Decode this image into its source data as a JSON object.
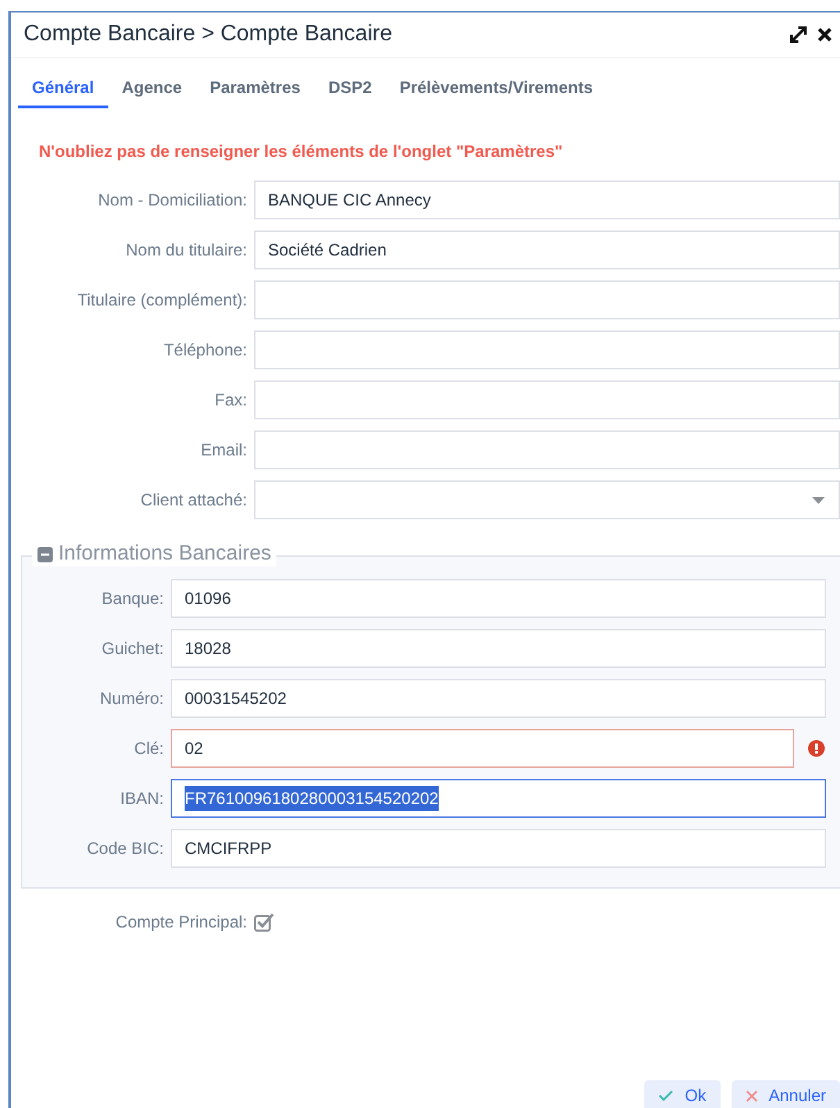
{
  "window": {
    "title": "Compte Bancaire > Compte Bancaire"
  },
  "tabs": [
    {
      "label": "Général",
      "selected": true
    },
    {
      "label": "Agence",
      "selected": false
    },
    {
      "label": "Paramètres",
      "selected": false
    },
    {
      "label": "DSP2",
      "selected": false
    },
    {
      "label": "Prélèvements/Virements",
      "selected": false
    }
  ],
  "warning": "N'oubliez pas de renseigner les éléments de l'onglet \"Paramètres\"",
  "fields": [
    {
      "label": "Nom - Domiciliation:",
      "value": "BANQUE CIC Annecy",
      "kind": "text"
    },
    {
      "label": "Nom du titulaire:",
      "value": "Société Cadrien",
      "kind": "text"
    },
    {
      "label": "Titulaire (complément):",
      "kind": "text"
    },
    {
      "label": "Téléphone:",
      "kind": "text"
    },
    {
      "label": "Fax:",
      "kind": "text"
    },
    {
      "label": "Email:",
      "kind": "text"
    },
    {
      "label": "Client attaché:",
      "kind": "select"
    }
  ],
  "bank_info": {
    "legend": "Informations Bancaires",
    "expanded": true,
    "fields": [
      {
        "label": "Banque:",
        "value": "01096",
        "error": false,
        "focused": false
      },
      {
        "label": "Guichet:",
        "value": "18028",
        "error": false,
        "focused": false
      },
      {
        "label": "Numéro:",
        "value": "00031545202",
        "error": false,
        "focused": false
      },
      {
        "label": "Clé:",
        "value": "02",
        "error": true,
        "focused": false
      },
      {
        "label": "IBAN:",
        "value": "FR7610096180280003154520202",
        "error": false,
        "focused": true
      },
      {
        "label": "Code BIC:",
        "value": "CMCIFRPP",
        "error": false,
        "focused": false
      }
    ]
  },
  "main_account": {
    "label": "Compte Principal:",
    "checked": true
  },
  "buttons": [
    {
      "label": "Ok",
      "kind": "ok"
    },
    {
      "label": "Annuler",
      "kind": "cancel"
    }
  ]
}
